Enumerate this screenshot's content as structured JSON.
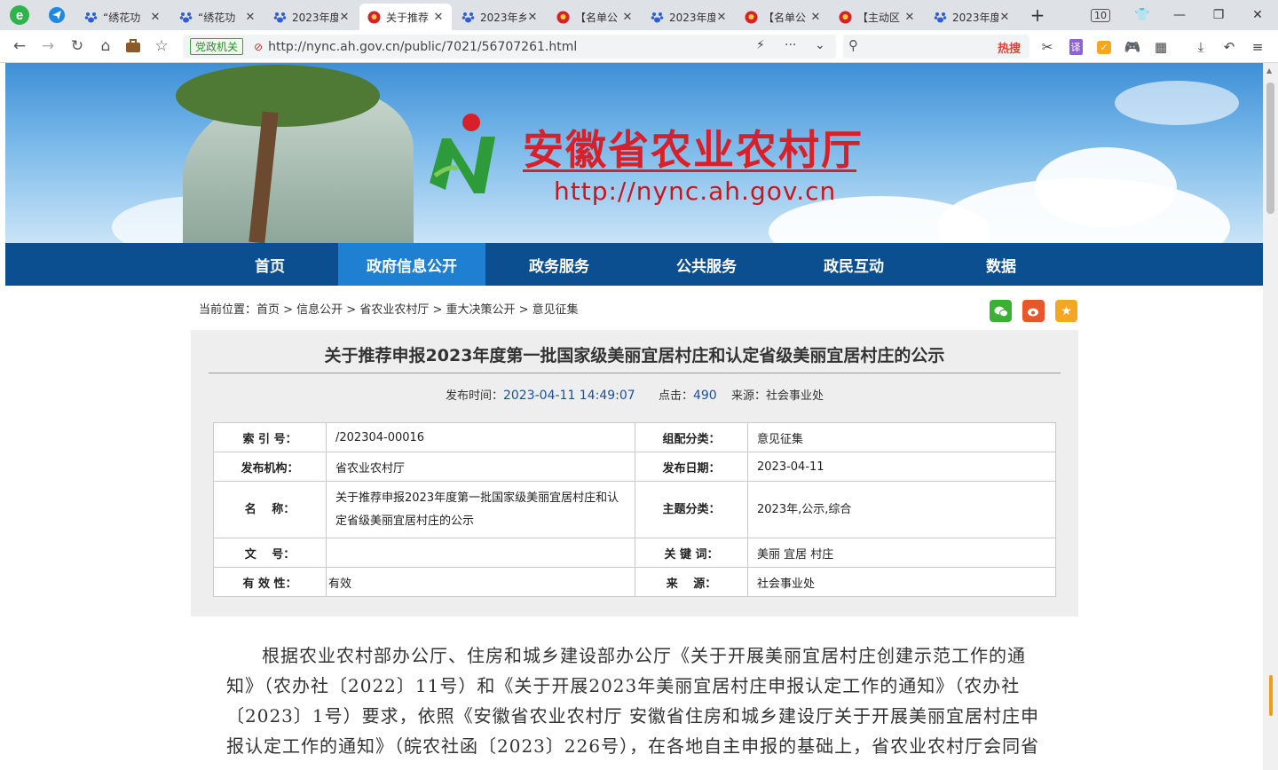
{
  "tabs": [
    {
      "label": "“绣花功",
      "icon": "baidu-paw"
    },
    {
      "label": "“绣花功",
      "icon": "baidu-paw"
    },
    {
      "label": "2023年度",
      "icon": "baidu-paw"
    },
    {
      "label": "关于推荐",
      "icon": "emblem",
      "active": true
    },
    {
      "label": "2023年乡",
      "icon": "baidu-paw"
    },
    {
      "label": "【名单公",
      "icon": "emblem"
    },
    {
      "label": "2023年度",
      "icon": "baidu-paw"
    },
    {
      "label": "【名单公",
      "icon": "emblem"
    },
    {
      "label": "【主动区",
      "icon": "emblem"
    },
    {
      "label": "2023年度",
      "icon": "baidu-paw"
    }
  ],
  "tab_count": "10",
  "address": {
    "badge": "党政机关",
    "url": "http://nync.ah.gov.cn/public/7021/56707261.html"
  },
  "search": {
    "hot_label": "热搜"
  },
  "site": {
    "title": "安徽省农业农村厅",
    "url": "http://nync.ah.gov.cn"
  },
  "menu": [
    "首页",
    "政府信息公开",
    "政务服务",
    "公共服务",
    "政民互动",
    "数据"
  ],
  "menu_active_index": 1,
  "breadcrumb": "当前位置：首页 > 信息公开 > 省农业农村厅 > 重大决策公开 > 意见征集",
  "article": {
    "title": "关于推荐申报2023年度第一批国家级美丽宜居村庄和认定省级美丽宜居村庄的公示",
    "publish_label": "发布时间：",
    "publish_time": "2023-04-11 14:49:07",
    "clicks_label": "点击：",
    "clicks": "490",
    "source_label": "来源：社会事业处"
  },
  "info": {
    "index_k": "索 引 号：",
    "index_v": "/202304-00016",
    "cat_k": "组配分类：",
    "cat_v": "意见征集",
    "org_k": "发布机构：",
    "org_v": "省农业农村厅",
    "date_k": "发布日期：",
    "date_v": "2023-04-11",
    "name_k": "名　 称：",
    "name_v": "关于推荐申报2023年度第一批国家级美丽宜居村庄和认定省级美丽宜居村庄的公示",
    "topic_k": "主题分类：",
    "topic_v": "2023年,公示,综合",
    "doc_k": "文　 号：",
    "doc_v": "",
    "kw_k": "关 键 词：",
    "kw_v": "美丽 宜居 村庄",
    "valid_k": "有 效 性：",
    "valid_v": "有效",
    "src_k": "来　 源：",
    "src_v": "社会事业处"
  },
  "body": "根据农业农村部办公厅、住房和城乡建设部办公厅《关于开展美丽宜居村庄创建示范工作的通知》（农办社〔2022〕11号）和《关于开展2023年美丽宜居村庄申报认定工作的通知》（农办社〔2023〕1号）要求，依照《安徽省农业农村厅 安徽省住房和城乡建设厅关于开展美丽宜居村庄申报认定工作的通知》（皖农社函〔2023〕226号），在各地自主申报的基础上，省农业农村厅会同省"
}
